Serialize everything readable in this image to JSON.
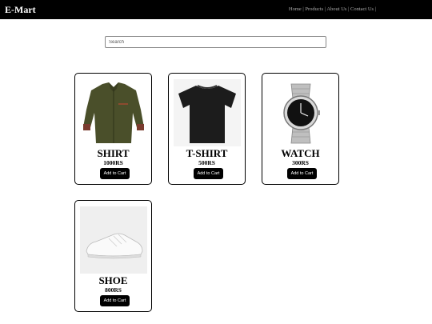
{
  "brand": "E-Mart",
  "nav": {
    "links": [
      "Home",
      "Products",
      "About Us",
      "Contact Us"
    ],
    "separator": "|"
  },
  "search": {
    "placeholder": "Search"
  },
  "products": [
    {
      "name": "SHIRT",
      "price": "1000RS",
      "button": "Add to Cart",
      "image_icon": "shirt-image"
    },
    {
      "name": "T-SHIRT",
      "price": "500RS",
      "button": "Add to Cart",
      "image_icon": "tshirt-image"
    },
    {
      "name": "WATCH",
      "price": "300RS",
      "button": "Add to Cart",
      "image_icon": "watch-image"
    },
    {
      "name": "SHOE",
      "price": "800RS",
      "button": "Add to Cart",
      "image_icon": "shoe-image"
    }
  ]
}
